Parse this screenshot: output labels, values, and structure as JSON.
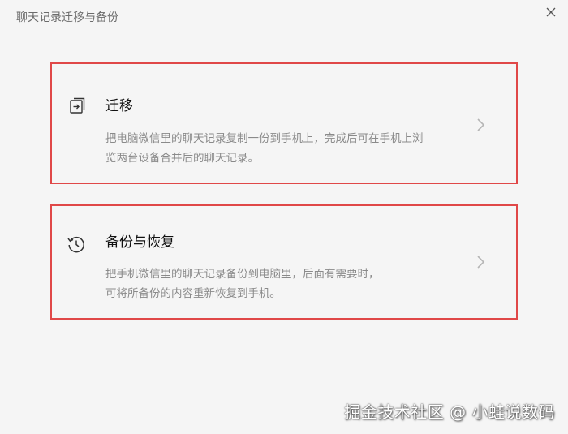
{
  "window": {
    "title": "聊天记录迁移与备份"
  },
  "cards": {
    "migrate": {
      "title": "迁移",
      "description_line1": "把电脑微信里的聊天记录复制一份到手机上，完成后可在手机上浏",
      "description_line2": "览两台设备合并后的聊天记录。"
    },
    "backup": {
      "title": "备份与恢复",
      "description_line1": "把手机微信里的聊天记录备份到电脑里，后面有需要时，",
      "description_line2": "可将所备份的内容重新恢复到手机。"
    }
  },
  "watermark": {
    "text": "掘金技术社区 @ 小蛙说数码"
  },
  "colors": {
    "background": "#f5f5f5",
    "highlight_border": "#e04848",
    "title_text": "#6b6b6b",
    "description_text": "#8a8a8a"
  },
  "icons": {
    "close": "close-icon",
    "migrate": "migrate-icon",
    "backup": "history-icon",
    "chevron": "chevron-right-icon"
  }
}
